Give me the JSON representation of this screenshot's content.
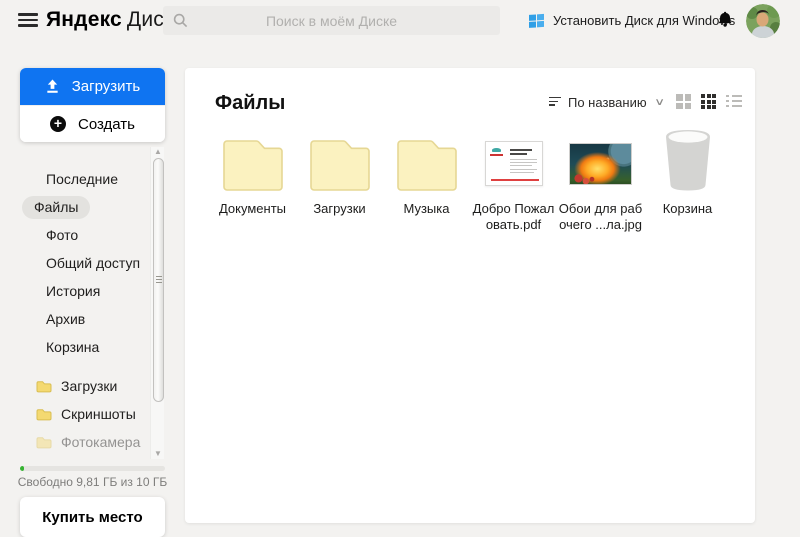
{
  "header": {
    "brand": "Яндекс",
    "product": "Диск",
    "search_placeholder": "Поиск в моём Диске",
    "install_label": "Установить Диск для Windows"
  },
  "sidebar": {
    "upload_label": "Загрузить",
    "create_label": "Создать",
    "nav_items": [
      {
        "label": "Последние",
        "active": false
      },
      {
        "label": "Файлы",
        "active": true
      },
      {
        "label": "Фото",
        "active": false
      },
      {
        "label": "Общий доступ",
        "active": false
      },
      {
        "label": "История",
        "active": false
      },
      {
        "label": "Архив",
        "active": false
      },
      {
        "label": "Корзина",
        "active": false
      }
    ],
    "folder_shortcuts": [
      {
        "label": "Загрузки",
        "faded": false
      },
      {
        "label": "Скриншоты",
        "faded": false
      },
      {
        "label": "Фотокамера",
        "faded": true
      }
    ],
    "storage_text": "Свободно 9,81 ГБ из 10 ГБ",
    "storage_used_percent": 3,
    "buy_label": "Купить место"
  },
  "main": {
    "title": "Файлы",
    "sort_label": "По названию",
    "active_view": "small-tiles",
    "tiles": [
      {
        "type": "folder",
        "lines": [
          "Документы"
        ]
      },
      {
        "type": "folder",
        "lines": [
          "Загрузки"
        ]
      },
      {
        "type": "folder",
        "lines": [
          "Музыка"
        ]
      },
      {
        "type": "pdf",
        "lines": [
          "Добро Пожал",
          "овать.pdf"
        ]
      },
      {
        "type": "image",
        "lines": [
          "Обои для раб",
          "очего ...ла.jpg"
        ]
      },
      {
        "type": "trash",
        "lines": [
          "Корзина"
        ]
      }
    ]
  },
  "icons": {
    "menu": "hamburger",
    "search": "magnifier",
    "windows": "windows-flag",
    "notifications": "bell",
    "upload": "arrow-up-from-line",
    "create": "plus-circle",
    "sort": "descending-lines",
    "sort_chevron": "⌄",
    "view_large": "grid-2x2",
    "view_small": "grid-3x3",
    "view_list": "list-bullets"
  },
  "colors": {
    "page_bg": "#f3f2f0",
    "accent_blue": "#0f74f1",
    "folder_fill": "#fbf2c0",
    "folder_border": "#e6d794",
    "progress_green": "#35b331",
    "active_pill": "#e3e2df"
  }
}
